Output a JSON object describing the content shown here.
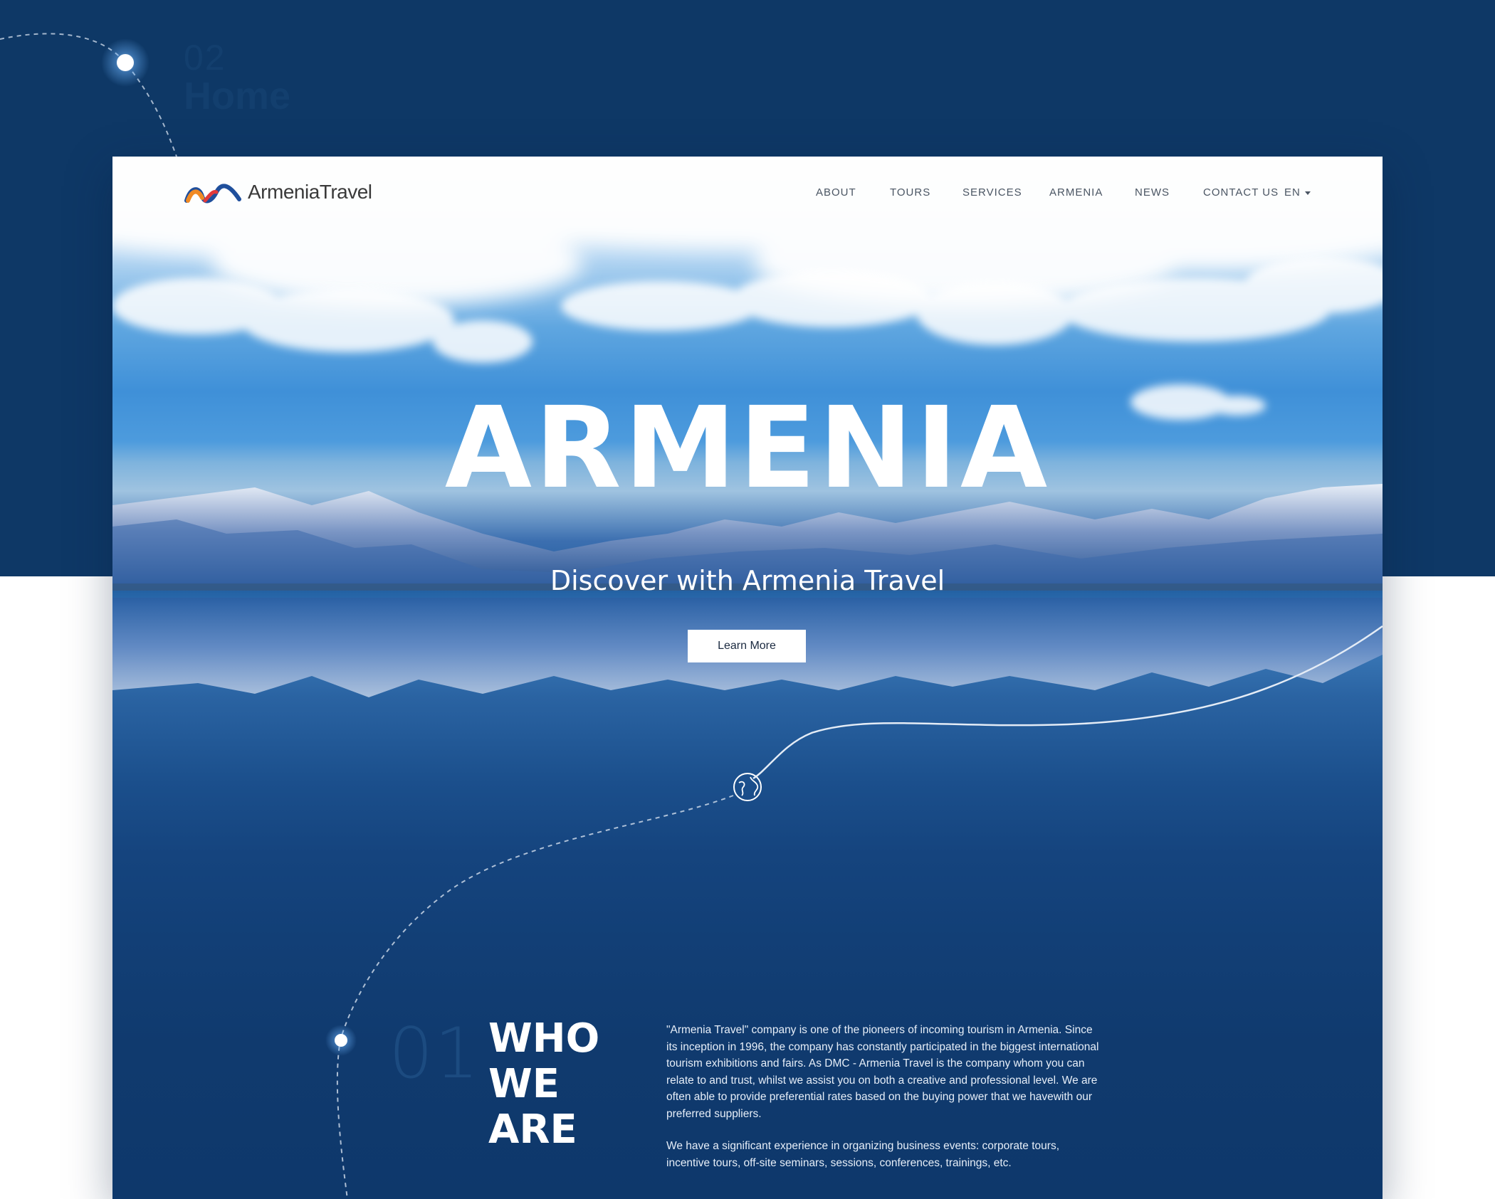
{
  "presentation": {
    "page_number": "02",
    "page_label": "Home",
    "colors": {
      "background_dark": "#0e3866",
      "label_color": "#133f6e",
      "accent_white": "#ffffff"
    }
  },
  "site": {
    "logo_text": "ArmeniaTravel",
    "nav": [
      {
        "label": "ABOUT"
      },
      {
        "label": "TOURS"
      },
      {
        "label": "SERVICES"
      },
      {
        "label": "ARMENIA"
      },
      {
        "label": "NEWS"
      },
      {
        "label": "CONTACT US"
      }
    ],
    "language": "EN",
    "hero": {
      "title": "ARMENIA",
      "subtitle": "Discover with Armenia Travel",
      "cta_label": "Learn More"
    },
    "about": {
      "number": "01",
      "title_lines": [
        "WHO",
        "WE",
        "ARE"
      ],
      "paragraphs": [
        "\"Armenia Travel\" company is one of the pioneers of incoming tourism in Armenia. Since its inception in 1996, the company has constantly participated in the biggest international tourism exhibitions and fairs. As DMC - Armenia Travel is the company whom you can relate to and trust, whilst we assist you on both a creative and professional level. We are often able to provide preferential rates based on the buying power that we havewith our preferred suppliers.",
        "We have a significant experience in organizing business events: corporate tours, incentive tours, off-site seminars, sessions, conferences, trainings, etc."
      ]
    },
    "icons": [
      "logo-mark-icon",
      "chevron-down-icon",
      "globe-icon"
    ]
  }
}
